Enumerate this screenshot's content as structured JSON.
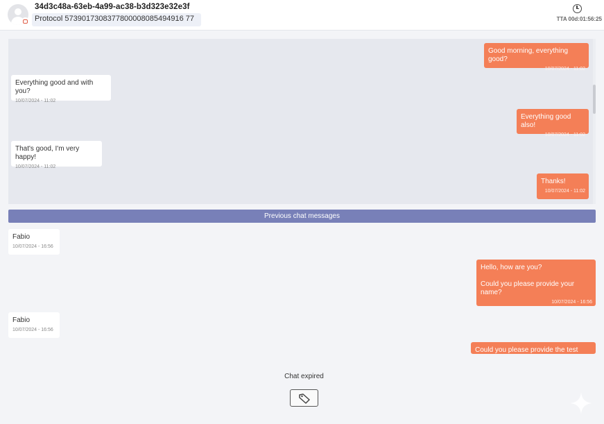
{
  "header": {
    "ticket_id": "34d3c48a-63eb-4a99-ac38-b3d323e32e3f",
    "protocol": "Protocol 5739017308377800008085494916 77",
    "tta": "TTA 00d:01:56:25"
  },
  "history_messages": [
    {
      "direction": "out",
      "text": "Good morning, everything good?",
      "time": "10/07/2024 - 11:02"
    },
    {
      "direction": "in",
      "text": "Everything good and with you?",
      "time": "10/07/2024 - 11:02"
    },
    {
      "direction": "out",
      "text": "Everything good also!",
      "time": "10/07/2024 - 11:02"
    },
    {
      "direction": "in",
      "text": "That's good, I'm very happy!",
      "time": "10/07/2024 - 11:02"
    },
    {
      "direction": "out",
      "text": "Thanks!",
      "time": "10/07/2024 - 11:02"
    }
  ],
  "divider_label": "Previous chat messages",
  "messages": [
    {
      "direction": "in",
      "text": "Fabio",
      "time": "10/07/2024 - 16:56"
    },
    {
      "direction": "out",
      "text": "Hello, how are you?\n\nCould you please provide your name?",
      "time": "10/07/2024 - 16:56"
    },
    {
      "direction": "in",
      "text": "Fabio",
      "time": "10/07/2024 - 16:56"
    },
    {
      "direction": "out",
      "text": "Could you please provide the test card?",
      "time": ""
    }
  ],
  "footer": {
    "status": "Chat expired",
    "tag_icon": "tag-icon",
    "sparkle_icon": "sparkle-icon"
  }
}
